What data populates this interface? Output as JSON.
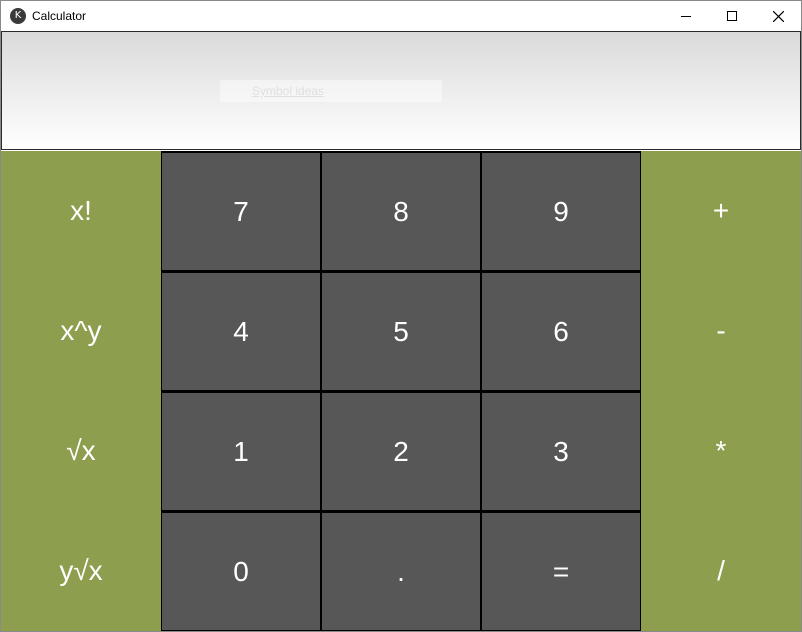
{
  "window": {
    "title": "Calculator",
    "app_icon_glyph": "K",
    "controls": [
      "minimize-icon",
      "maximize-icon",
      "close-icon"
    ]
  },
  "display": {
    "placeholder": "Symbol ideas"
  },
  "colors": {
    "function_key": "#8e9e4f",
    "number_key": "#575757",
    "key_text": "#ffffff"
  },
  "keys": {
    "factorial": "x!",
    "power": "x^y",
    "sqrt": "√x",
    "nth_root": "y√x",
    "seven": "7",
    "eight": "8",
    "nine": "9",
    "four": "4",
    "five": "5",
    "six": "6",
    "one": "1",
    "two": "2",
    "three": "3",
    "zero": "0",
    "dot": ".",
    "equals": "=",
    "plus": "+",
    "minus": "-",
    "multiply": "*",
    "divide": "/"
  }
}
